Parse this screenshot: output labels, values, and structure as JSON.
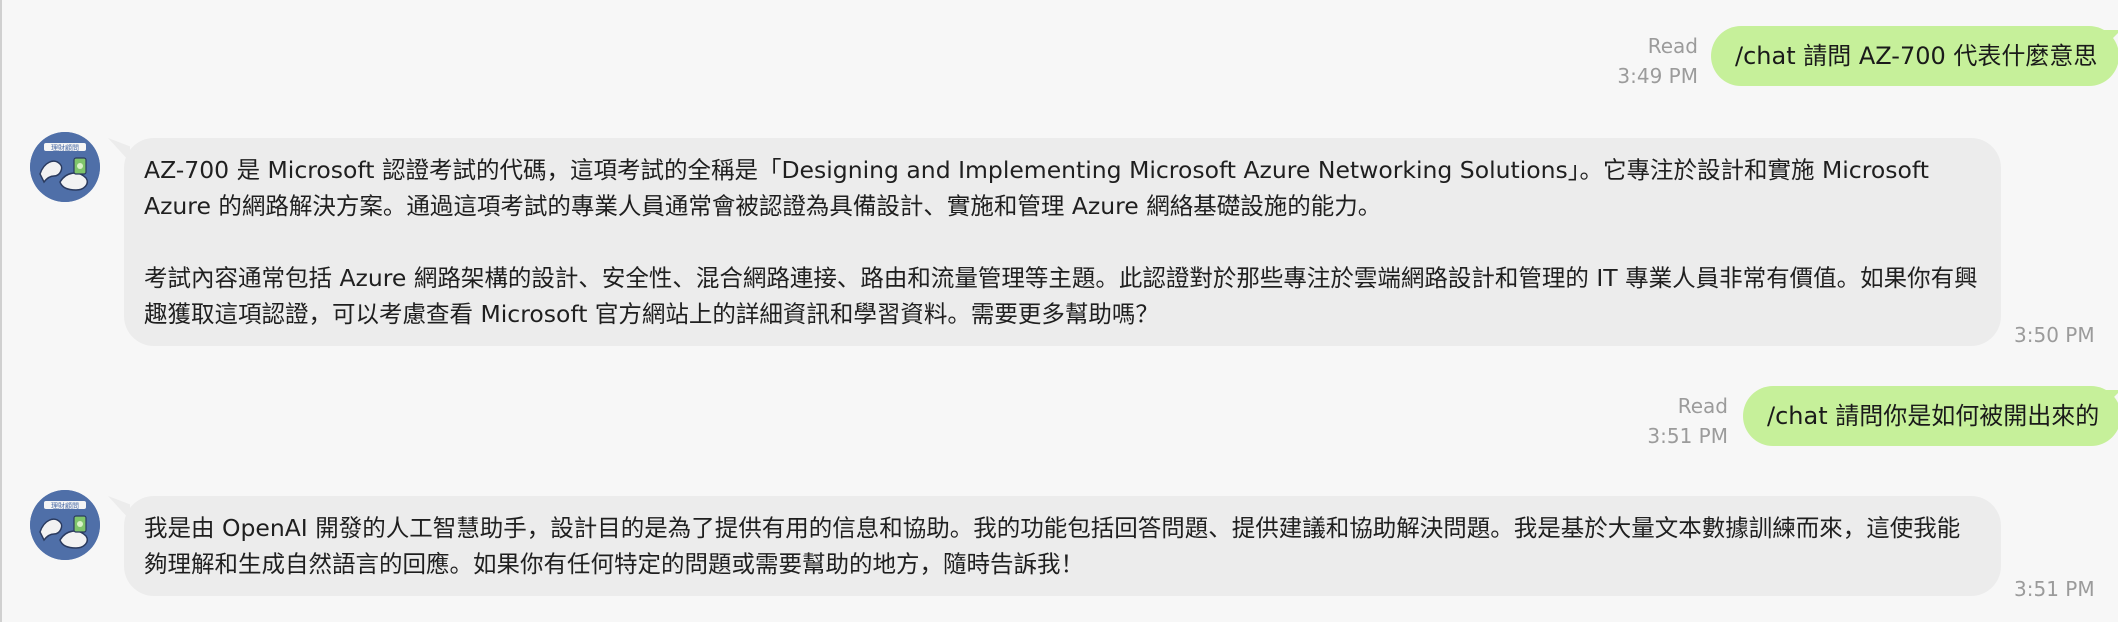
{
  "messages": [
    {
      "type": "outgoing",
      "read_label": "Read",
      "time": "3:49 PM",
      "text": "/chat 請問 AZ-700 代表什麼意思"
    },
    {
      "type": "incoming",
      "avatar_label": "理財顧問",
      "time": "3:50 PM",
      "paragraphs": [
        "AZ-700 是 Microsoft 認證考試的代碼，這項考試的全稱是「Designing and Implementing Microsoft Azure Networking Solutions」。它專注於設計和實施 Microsoft Azure 的網路解決方案。通過這項考試的專業人員通常會被認證為具備設計、實施和管理 Azure 網絡基礎設施的能力。",
        "考試內容通常包括 Azure 網路架構的設計、安全性、混合網路連接、路由和流量管理等主題。此認證對於那些專注於雲端網路設計和管理的 IT 專業人員非常有價值。如果你有興趣獲取這項認證，可以考慮查看 Microsoft 官方網站上的詳細資訊和學習資料。需要更多幫助嗎？"
      ]
    },
    {
      "type": "outgoing",
      "read_label": "Read",
      "time": "3:51 PM",
      "text": "/chat 請問你是如何被開出來的"
    },
    {
      "type": "incoming",
      "avatar_label": "理財顧問",
      "time": "3:51 PM",
      "paragraphs": [
        "我是由 OpenAI 開發的人工智慧助手，設計目的是為了提供有用的信息和協助。我的功能包括回答問題、提供建議和協助解決問題。我是基於大量文本數據訓練而來，這使我能夠理解和生成自然語言的回應。如果你有任何特定的問題或需要幫助的地方，隨時告訴我！"
      ]
    }
  ]
}
